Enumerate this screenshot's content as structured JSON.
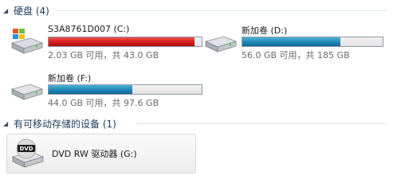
{
  "groups": {
    "hard_disks": {
      "title": "硬盘 (4)"
    },
    "removable": {
      "title": "有可移动存储的设备 (1)"
    }
  },
  "drives": [
    {
      "name": "S3A8761D007 (C:)",
      "space": "2.03 GB 可用，共 43.0 GB",
      "used_fraction": 0.953,
      "bar_color": "#c81616",
      "icon": "windows-drive-icon"
    },
    {
      "name": "新加卷 (D:)",
      "space": "56.0 GB 可用，共 185 GB",
      "used_fraction": 0.697,
      "bar_color": "#1f86b6",
      "icon": "hard-drive-icon"
    },
    {
      "name": "新加卷 (F:)",
      "space": "44.0 GB 可用，共 97.6 GB",
      "used_fraction": 0.549,
      "bar_color": "#1f86b6",
      "icon": "hard-drive-icon"
    }
  ],
  "removable_devices": [
    {
      "name": "DVD RW 驱动器 (G:)",
      "icon": "dvd-drive-icon",
      "icon_label": "DVD"
    }
  ]
}
